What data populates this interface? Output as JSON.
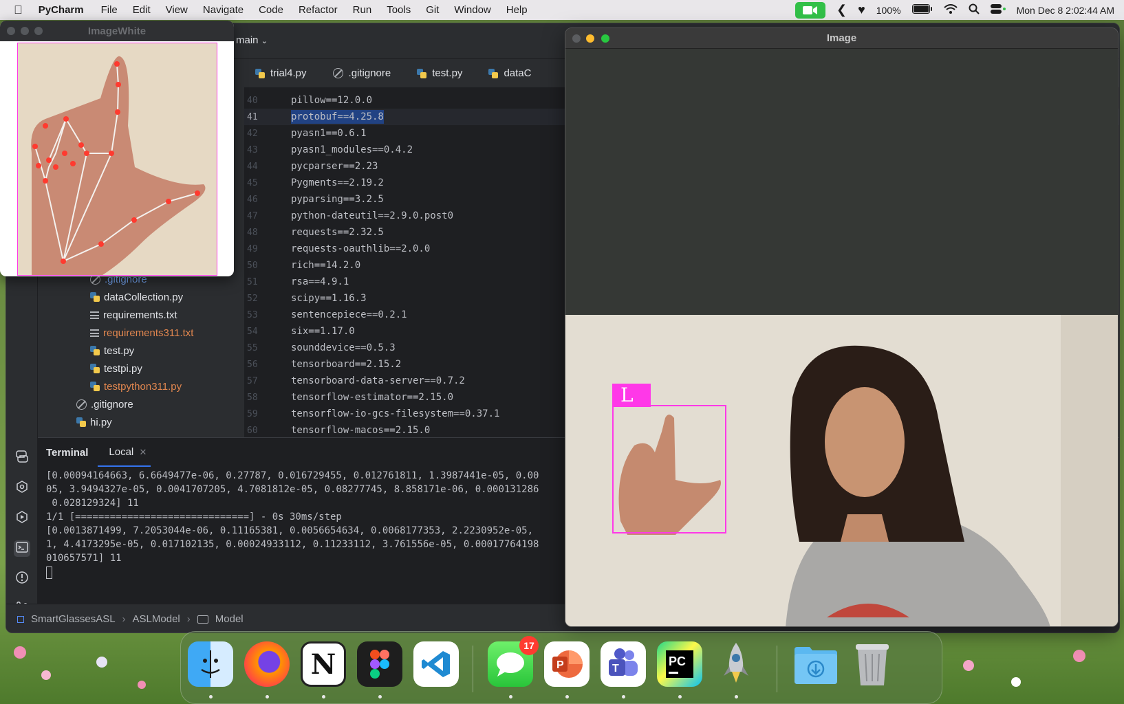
{
  "menubar": {
    "app": "PyCharm",
    "menus": [
      "File",
      "Edit",
      "View",
      "Navigate",
      "Code",
      "Refactor",
      "Run",
      "Tools",
      "Git",
      "Window",
      "Help"
    ],
    "battery": "100%",
    "datetime": "Mon Dec 8  2:02:44 AM"
  },
  "image_white_window": {
    "title": "ImageWhite"
  },
  "pycharm": {
    "branch": "main",
    "tabs": [
      {
        "label": "trial4.py",
        "icon": "python-file-icon"
      },
      {
        "label": ".gitignore",
        "icon": "ignore-file-icon"
      },
      {
        "label": "test.py",
        "icon": "python-file-icon"
      },
      {
        "label": "dataC",
        "icon": "python-file-icon"
      }
    ],
    "project_tree": [
      {
        "label": ".gitignore",
        "icon": "ignore-file-icon",
        "status": "git"
      },
      {
        "label": "dataCollection.py",
        "icon": "python-file-icon",
        "status": "normal"
      },
      {
        "label": "requirements.txt",
        "icon": "text-file-icon",
        "status": "normal"
      },
      {
        "label": "requirements311.txt",
        "icon": "text-file-icon",
        "status": "modified"
      },
      {
        "label": "test.py",
        "icon": "python-file-icon",
        "status": "normal"
      },
      {
        "label": "testpi.py",
        "icon": "python-file-icon",
        "status": "normal"
      },
      {
        "label": "testpython311.py",
        "icon": "python-file-icon",
        "status": "modified"
      },
      {
        "label": ".gitignore",
        "icon": "ignore-file-icon",
        "status": "normal"
      },
      {
        "label": "hi.py",
        "icon": "python-file-icon",
        "status": "normal"
      }
    ],
    "code_lines": [
      {
        "num": "40",
        "text": "pillow==12.0.0"
      },
      {
        "num": "41",
        "text": "protobuf==4.25.8"
      },
      {
        "num": "42",
        "text": "pyasn1==0.6.1"
      },
      {
        "num": "43",
        "text": "pyasn1_modules==0.4.2"
      },
      {
        "num": "44",
        "text": "pycparser==2.23"
      },
      {
        "num": "45",
        "text": "Pygments==2.19.2"
      },
      {
        "num": "46",
        "text": "pyparsing==3.2.5"
      },
      {
        "num": "47",
        "text": "python-dateutil==2.9.0.post0"
      },
      {
        "num": "48",
        "text": "requests==2.32.5"
      },
      {
        "num": "49",
        "text": "requests-oauthlib==2.0.0"
      },
      {
        "num": "50",
        "text": "rich==14.2.0"
      },
      {
        "num": "51",
        "text": "rsa==4.9.1"
      },
      {
        "num": "52",
        "text": "scipy==1.16.3"
      },
      {
        "num": "53",
        "text": "sentencepiece==0.2.1"
      },
      {
        "num": "54",
        "text": "six==1.17.0"
      },
      {
        "num": "55",
        "text": "sounddevice==0.5.3"
      },
      {
        "num": "56",
        "text": "tensorboard==2.15.2"
      },
      {
        "num": "57",
        "text": "tensorboard-data-server==0.7.2"
      },
      {
        "num": "58",
        "text": "tensorflow-estimator==2.15.0"
      },
      {
        "num": "59",
        "text": "tensorflow-io-gcs-filesystem==0.37.1"
      },
      {
        "num": "60",
        "text": "tensorflow-macos==2.15.0"
      }
    ],
    "current_line": "41",
    "terminal": {
      "title": "Terminal",
      "tab": "Local",
      "lines": [
        "[0.00094164663, 6.6649477e-06, 0.27787, 0.016729455, 0.012761811, 1.3987441e-05, 0.00",
        "05, 3.9494327e-05, 0.0041707205, 4.7081812e-05, 0.08277745, 8.858171e-06, 0.000131286",
        " 0.028129324] 11",
        "1/1 [==============================] - 0s 30ms/step",
        "[0.0013871499, 7.2053044e-06, 0.11165381, 0.0056654634, 0.0068177353, 2.2230952e-05,",
        "1, 4.4173295e-05, 0.017102135, 0.00024933112, 0.11233112, 3.761556e-05, 0.00017764198",
        "010657571] 11"
      ]
    },
    "breadcrumb": [
      "SmartGlassesASL",
      "ASLModel",
      "Model"
    ]
  },
  "image_window": {
    "title": "Image",
    "detection_label": "L"
  },
  "dock": {
    "apps": [
      {
        "name": "Finder",
        "icon": "finder-icon"
      },
      {
        "name": "Firefox",
        "icon": "firefox-icon"
      },
      {
        "name": "Notion",
        "icon": "notion-icon"
      },
      {
        "name": "Figma",
        "icon": "figma-icon"
      },
      {
        "name": "Visual Studio Code",
        "icon": "vscode-icon"
      },
      {
        "name": "Messages",
        "icon": "messages-icon",
        "badge": "17"
      },
      {
        "name": "PowerPoint",
        "icon": "powerpoint-icon"
      },
      {
        "name": "Teams",
        "icon": "teams-icon"
      },
      {
        "name": "PyCharm",
        "icon": "pycharm-icon"
      },
      {
        "name": "Python Launcher",
        "icon": "rocket-icon"
      },
      {
        "name": "Downloads",
        "icon": "downloads-folder-icon"
      },
      {
        "name": "Trash",
        "icon": "trash-icon"
      }
    ]
  },
  "colors": {
    "accent": "#ff38e8",
    "selection": "#214283",
    "git_ignored": "#6f9fe8",
    "modified": "#e0864f"
  }
}
